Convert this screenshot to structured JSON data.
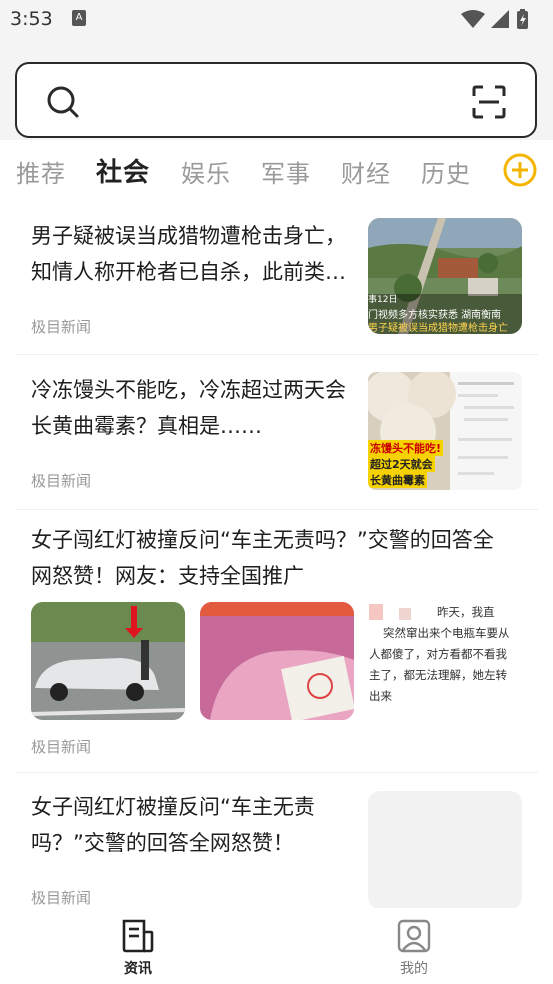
{
  "status_bar": {
    "time": "3:53"
  },
  "search": {
    "placeholder": ""
  },
  "tabs": [
    {
      "label": "推荐",
      "active": false
    },
    {
      "label": "社会",
      "active": true
    },
    {
      "label": "娱乐",
      "active": false
    },
    {
      "label": "军事",
      "active": false
    },
    {
      "label": "财经",
      "active": false
    },
    {
      "label": "历史",
      "active": false
    }
  ],
  "feed": [
    {
      "title_line1": "男子疑被误当成猎物遭枪击身亡，",
      "title_line2": "知情人称开枪者已自杀，此前类…",
      "source": "极目新闻",
      "thumb_caption1": "事12日",
      "thumb_caption2": "门视频多方核实获悉 湖南衡南",
      "thumb_caption3": "男子疑被误当成猎物遭枪击身亡"
    },
    {
      "title_line1": "冷冻馒头不能吃，冷冻超过两天会",
      "title_line2": "长黄曲霉素？真相是……",
      "source": "极目新闻",
      "thumb_caption1": "冻馒头不能吃!",
      "thumb_caption2": "超过2天就会",
      "thumb_caption3": "长黄曲霉素"
    },
    {
      "title_line1": "女子闯红灯被撞反问“车主无责吗？”交警的回答全",
      "title_line2": "网怒赞！网友：支持全国推广",
      "source": "极目新闻",
      "img3_lines": [
        "昨天，我直",
        "突然窜出来个电瓶车要从",
        "人都傻了，对方看都不看我",
        "主了，都无法理解，她左转",
        "出来"
      ]
    },
    {
      "title_line1": "女子闯红灯被撞反问“车主无责",
      "title_line2": "吗？”交警的回答全网怒赞！",
      "source": "极目新闻"
    }
  ],
  "bottom_nav": [
    {
      "label": "资讯",
      "active": true
    },
    {
      "label": "我的",
      "active": false
    }
  ],
  "colors": {
    "accent": "#f5b400",
    "text": "#1e1e1e",
    "muted": "#9a9a9a"
  }
}
